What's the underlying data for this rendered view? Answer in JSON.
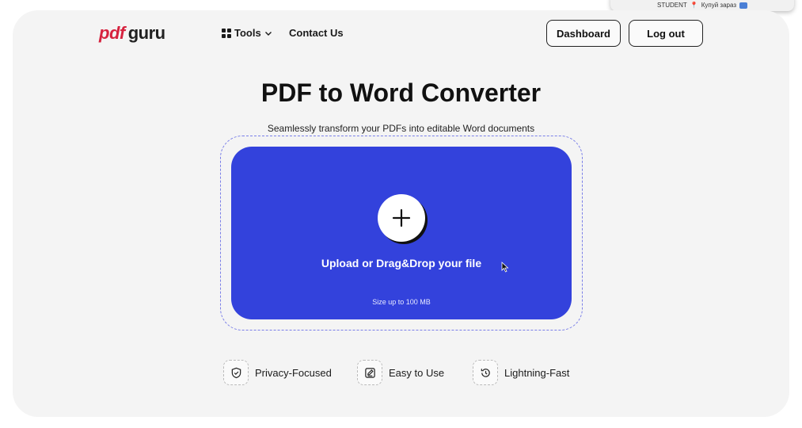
{
  "popup": {
    "text": "STUDENT",
    "extra": "Купуй зараз"
  },
  "header": {
    "logo_pdf": "pdf",
    "logo_guru": "guru",
    "nav": {
      "tools": "Tools",
      "contact": "Contact Us"
    },
    "dashboard": "Dashboard",
    "logout": "Log out"
  },
  "main": {
    "title": "PDF to Word Converter",
    "subtitle": "Seamlessly transform your PDFs into editable Word documents",
    "upload_label": "Upload or Drag&Drop your file",
    "size_note": "Size up to 100 MB"
  },
  "features": [
    {
      "label": "Privacy-Focused",
      "icon": "shield-check-icon"
    },
    {
      "label": "Easy to Use",
      "icon": "edit-note-icon"
    },
    {
      "label": "Lightning-Fast",
      "icon": "history-clock-icon"
    }
  ],
  "colors": {
    "accent": "#3342dc",
    "brand_red": "#d6233f",
    "card_bg": "#f4f4f4"
  }
}
